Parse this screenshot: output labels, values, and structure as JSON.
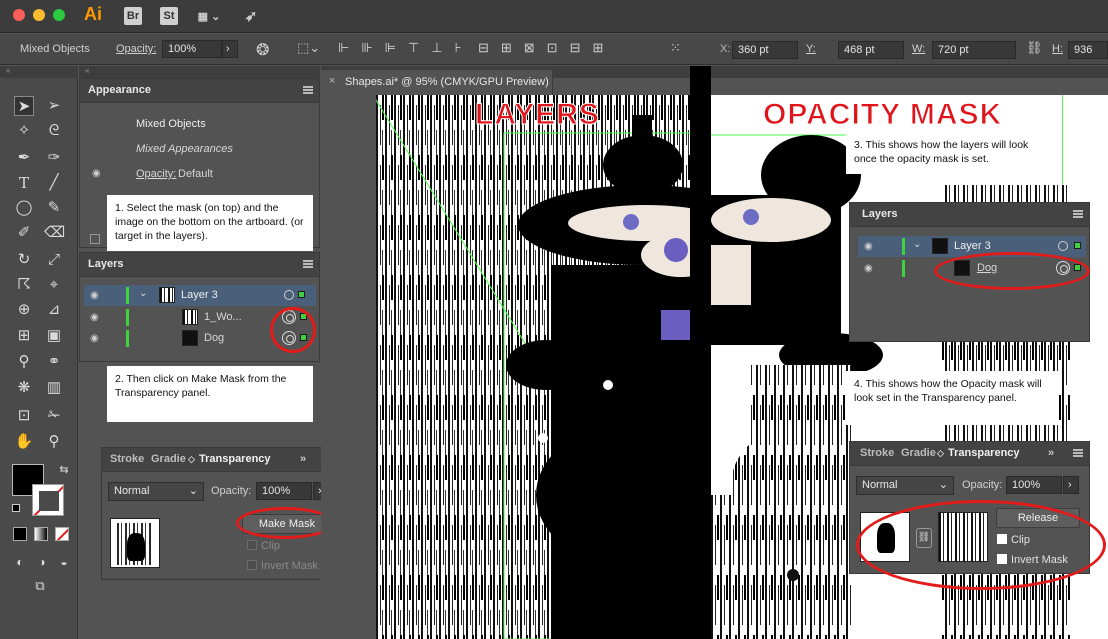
{
  "app": {
    "logo": "Ai",
    "bridge": "Br",
    "stock": "St"
  },
  "control_bar": {
    "selection_label": "Mixed Objects",
    "opacity_label": "Opacity:",
    "opacity_value": "100%",
    "x_label": "X:",
    "x_value": "360 pt",
    "y_label": "Y:",
    "y_value": "468 pt",
    "w_label": "W:",
    "w_value": "720 pt",
    "h_label": "H:",
    "h_value": "936"
  },
  "document_tab": {
    "title": "Shapes.ai* @ 95% (CMYK/GPU Preview)"
  },
  "appearance_panel": {
    "title": "Appearance",
    "rows": [
      "Mixed Objects",
      "Mixed Appearances"
    ],
    "opacity_label": "Opacity:",
    "opacity_value": "Default"
  },
  "layers_panel_left": {
    "title": "Layers",
    "layer_name": "Layer 3",
    "items": [
      "1_Wo...",
      "Dog"
    ]
  },
  "transparency_panel_left": {
    "tabs": [
      "Stroke",
      "Gradie",
      "Transparency"
    ],
    "blend_mode": "Normal",
    "opacity_label": "Opacity:",
    "opacity_value": "100%",
    "make_mask_label": "Make Mask",
    "clip_label": "Clip",
    "invert_label": "Invert Mask"
  },
  "notes": {
    "note1": "1. Select the mask (on top) and the image on the bottom on the artboard. (or target in the layers).",
    "note2": "2. Then click on Make Mask from the Transparency panel.",
    "note3": "3. This shows how the layers will look once the opacity  mask is set.",
    "note4": "4. This shows how the Opacity mask will look set in the Transparency panel."
  },
  "headings": {
    "left": "LAYERS",
    "right": "OPACITY MASK"
  },
  "layers_panel_right": {
    "title": "Layers",
    "layer_name": "Layer 3",
    "item": "Dog"
  },
  "transparency_panel_right": {
    "tabs": [
      "Stroke",
      "Gradie",
      "Transparency"
    ],
    "blend_mode": "Normal",
    "opacity_label": "Opacity:",
    "opacity_value": "100%",
    "release_label": "Release",
    "clip_label": "Clip",
    "invert_label": "Invert Mask"
  },
  "colors": {
    "annotation_red": "#e21b1b",
    "layer_green": "#3fd23f",
    "heading_red": "#e0141b",
    "selection_blue": "#4a5f7a"
  }
}
